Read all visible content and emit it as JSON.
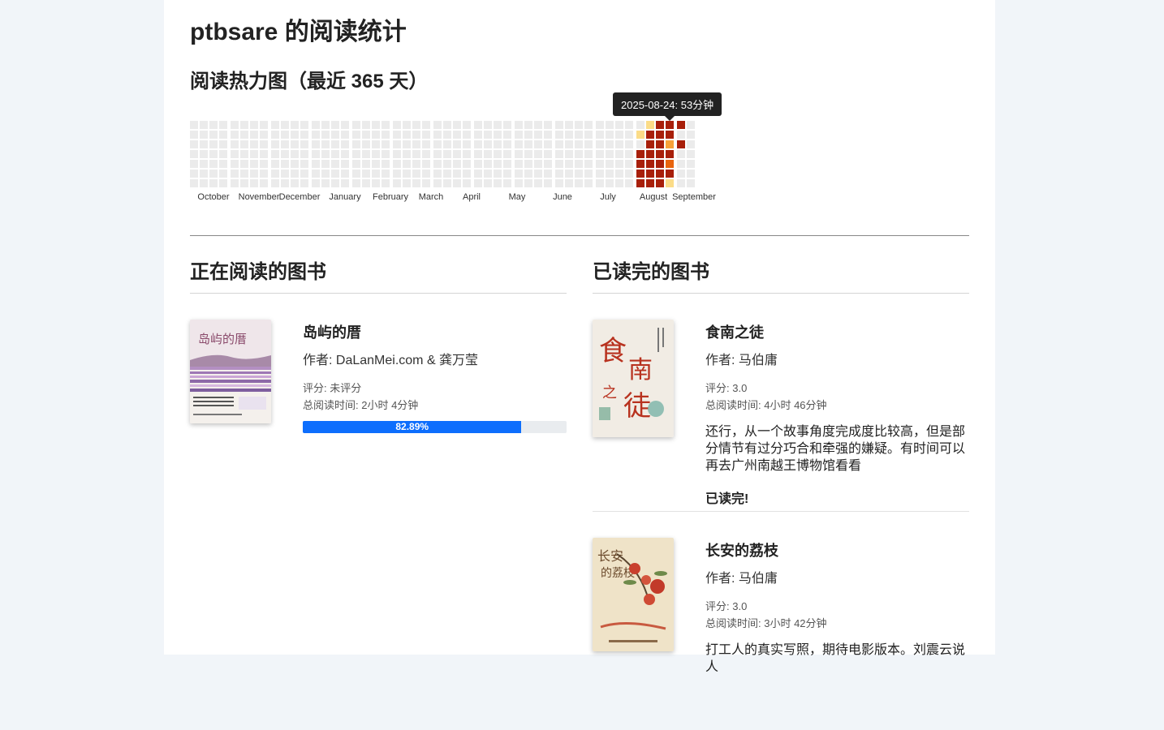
{
  "page_title": "ptbsare 的阅读统计",
  "heatmap": {
    "title": "阅读热力图（最近 365 天）",
    "months": [
      "October",
      "November",
      "December",
      "January",
      "February",
      "March",
      "April",
      "May",
      "June",
      "July",
      "August",
      "September"
    ],
    "tooltip": "2025-08-24: 53分钟",
    "colors": {
      "empty": "#ebebeb",
      "light": "#fbdc88",
      "medium": "#f6a23a",
      "high": "#e8650f",
      "highest": "#a81f0a"
    }
  },
  "reading": {
    "heading": "正在阅读的图书",
    "books": [
      {
        "title": "岛屿的厝",
        "author": "作者: DaLanMei.com & 龚万莹",
        "rating": "评分: 未评分",
        "total_time": "总阅读时间: 2小时 4分钟",
        "progress": 82.89,
        "progress_label": "82.89%"
      }
    ]
  },
  "finished": {
    "heading": "已读完的图书",
    "books": [
      {
        "title": "食南之徒",
        "author": "作者: 马伯庸",
        "rating": "评分: 3.0",
        "total_time": "总阅读时间: 4小时 46分钟",
        "review": "还行，从一个故事角度完成度比较高，但是部分情节有过分巧合和牵强的嫌疑。有时间可以再去广州南越王博物馆看看",
        "status": "已读完!"
      },
      {
        "title": "长安的荔枝",
        "author": "作者: 马伯庸",
        "rating": "评分: 3.0",
        "total_time": "总阅读时间: 3小时 42分钟",
        "review": "打工人的真实写照，期待电影版本。刘震云说人"
      }
    ]
  }
}
